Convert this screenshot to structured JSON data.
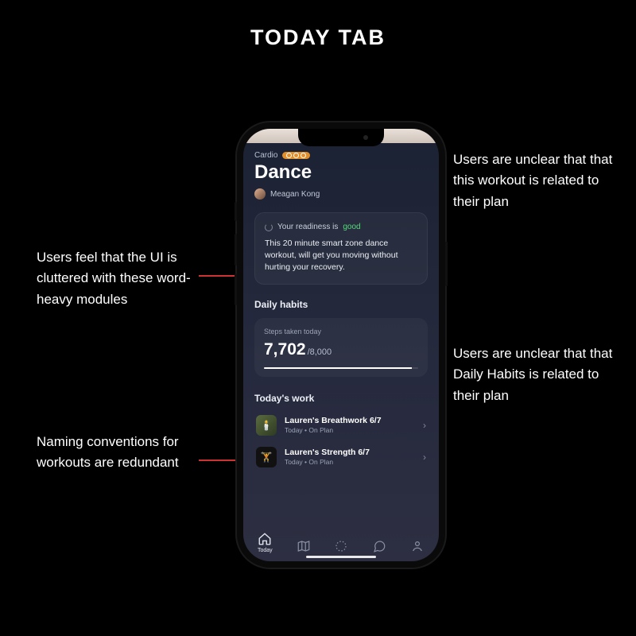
{
  "page_title": "TODAY TAB",
  "annotations": {
    "top_right": "Users are unclear that that this workout is related to their plan",
    "mid_left": "Users feel that the UI is cluttered with these word-heavy modules",
    "mid_right": "Users are unclear that that Daily Habits is related to their plan",
    "bottom_left": "Naming conventions for workouts are redundant"
  },
  "workout": {
    "category": "Cardio",
    "title": "Dance",
    "author": "Meagan Kong"
  },
  "readiness": {
    "prefix": "Your readiness is ",
    "value": "good",
    "description": "This 20 minute smart zone dance workout, will get you moving without hurting your recovery."
  },
  "daily_habits": {
    "heading": "Daily habits",
    "steps_label": "Steps taken today",
    "steps_value": "7,702",
    "steps_goal": "/8,000"
  },
  "todays_work": {
    "heading": "Today's work",
    "items": [
      {
        "title": "Lauren's Breathwork 6/7",
        "sub": "Today • On Plan"
      },
      {
        "title": "Lauren's Strength 6/7",
        "sub": "Today • On Plan"
      }
    ]
  },
  "tabs": {
    "today": "Today"
  }
}
